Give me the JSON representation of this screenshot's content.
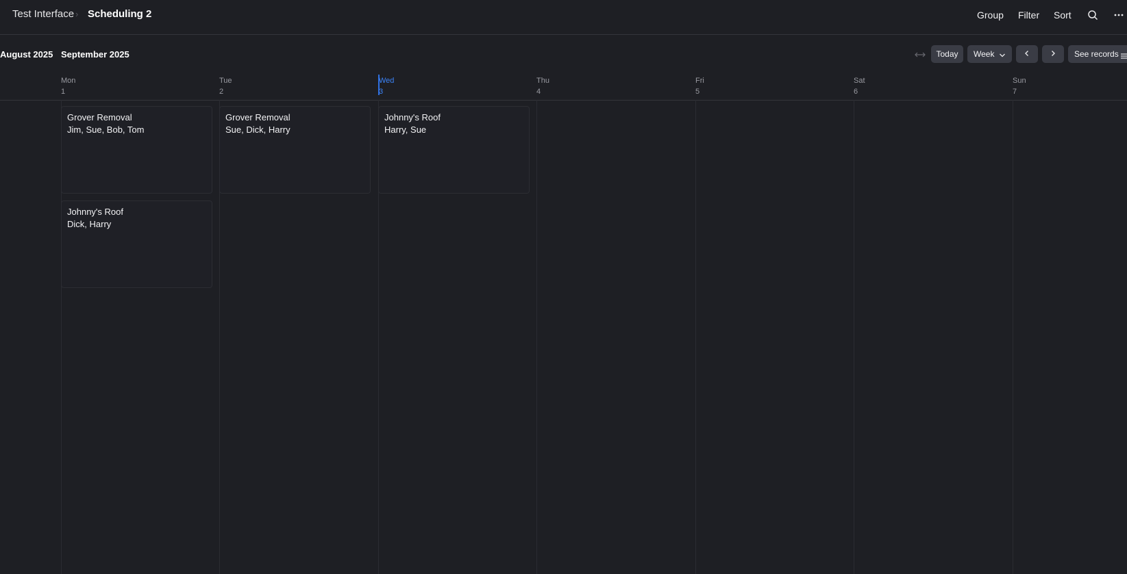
{
  "header": {
    "app_name": "Test Interface",
    "separator": "›",
    "page_title": "Scheduling 2",
    "actions": {
      "group": "Group",
      "filter": "Filter",
      "sort": "Sort"
    },
    "icons": {
      "search": "search-icon",
      "more": "more-horizontal-icon"
    }
  },
  "calendar": {
    "prev_month": "August 2025",
    "current_month": "September 2025",
    "toolbar": {
      "expand_icon": "expand-horizontal-icon",
      "today": "Today",
      "view": "Week",
      "prev_icon": "chevron-left-icon",
      "next_icon": "chevron-right-icon",
      "see_records": "See records",
      "records_icon": "list-icon"
    },
    "days": [
      {
        "name": "Mon",
        "date": "1"
      },
      {
        "name": "Tue",
        "date": "2"
      },
      {
        "name": "Wed",
        "date": "3",
        "today": true
      },
      {
        "name": "Thu",
        "date": "4"
      },
      {
        "name": "Fri",
        "date": "5"
      },
      {
        "name": "Sat",
        "date": "6"
      },
      {
        "name": "Sun",
        "date": "7"
      }
    ],
    "events": [
      {
        "day": "Mon",
        "title": "Grover Removal",
        "people": "Jim, Sue, Bob, Tom"
      },
      {
        "day": "Tue",
        "title": "Grover Removal",
        "people": "Sue, Dick, Harry"
      },
      {
        "day": "Wed",
        "title": "Johnny's Roof",
        "people": "Harry, Sue"
      },
      {
        "day": "Mon",
        "title": "Johnny's Roof",
        "people": "Dick, Harry"
      }
    ]
  },
  "colors": {
    "background": "#1e1f24",
    "accent": "#3b82f6",
    "pill": "#3a3c45"
  }
}
